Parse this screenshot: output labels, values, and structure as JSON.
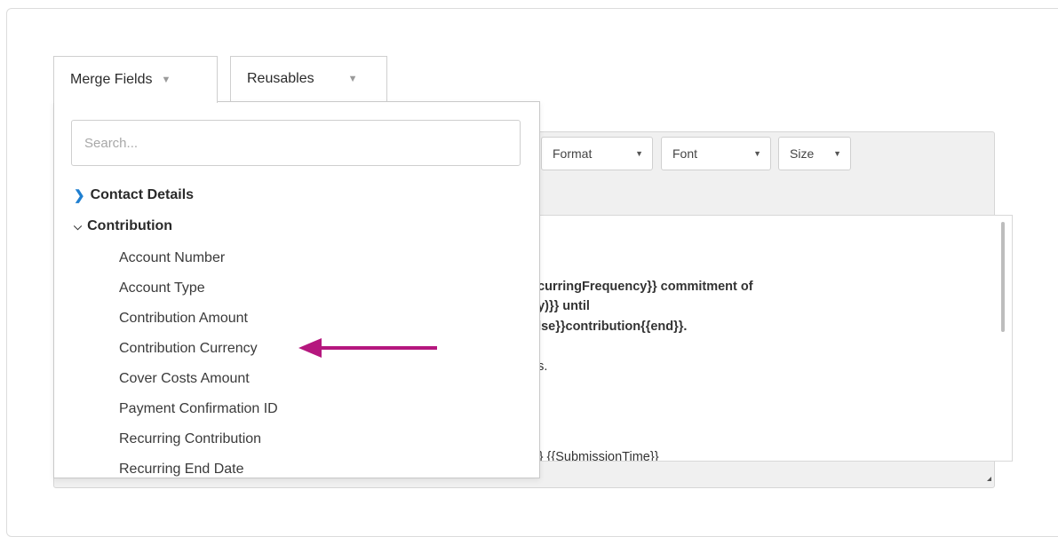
{
  "toolbar": {
    "merge_fields_label": "Merge Fields",
    "reusables_label": "Reusables"
  },
  "editor_toolbar": {
    "format_label": "Format",
    "font_label": "Font",
    "size_label": "Size"
  },
  "dropdown": {
    "search_placeholder": "Search...",
    "groups": [
      {
        "label": "Contact Details",
        "expanded": false
      },
      {
        "label": "Contribution",
        "expanded": true
      }
    ],
    "items": [
      "Account Number",
      "Account Type",
      "Contribution Amount",
      "Contribution Currency",
      "Cover Costs Amount",
      "Payment Confirmation ID",
      "Recurring Contribution",
      "Recurring End Date"
    ],
    "highlighted_item": "Contribution Currency"
  },
  "editor_content": {
    "line1": "ecurringFrequency}} commitment of",
    "line2": "cy)}} until",
    "line3": "else}}contribution{{end}}.",
    "line4": "ds.",
    "line5": ")}} {{SubmissionTime}}"
  },
  "colors": {
    "arrow": "#b5177e",
    "group_chevron": "#1f7fd0"
  }
}
